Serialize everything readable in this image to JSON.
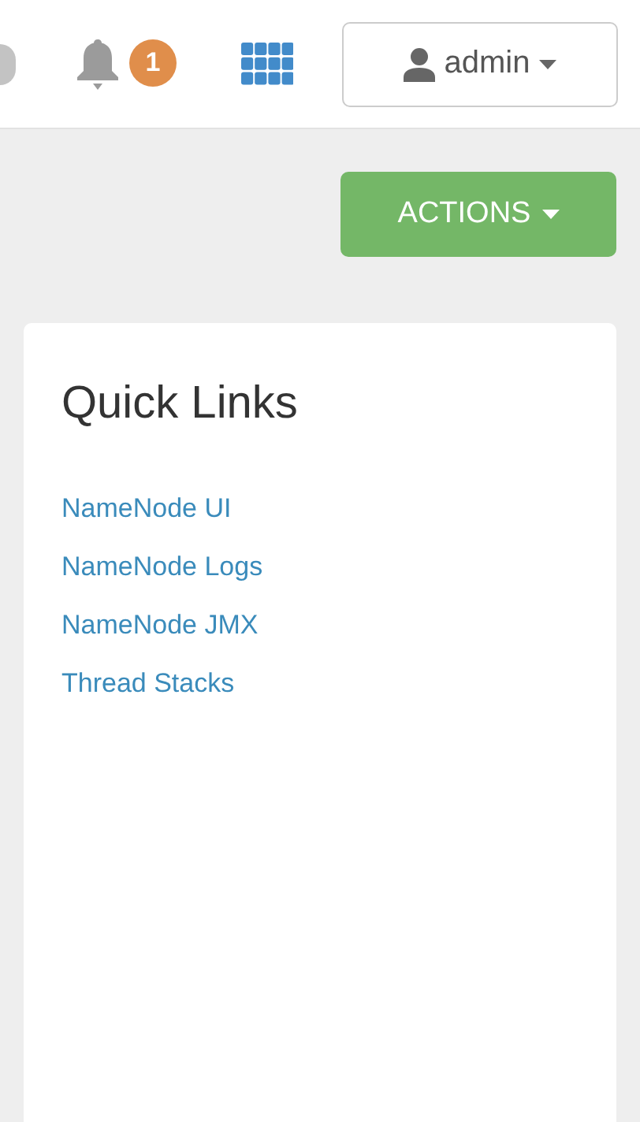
{
  "navbar": {
    "notifications": {
      "count": "1"
    },
    "user_menu": {
      "label": "admin"
    }
  },
  "actions_button": {
    "label": "ACTIONS"
  },
  "quick_links": {
    "title": "Quick Links",
    "links": [
      "NameNode UI",
      "NameNode Logs",
      "NameNode JMX",
      "Thread Stacks"
    ]
  }
}
